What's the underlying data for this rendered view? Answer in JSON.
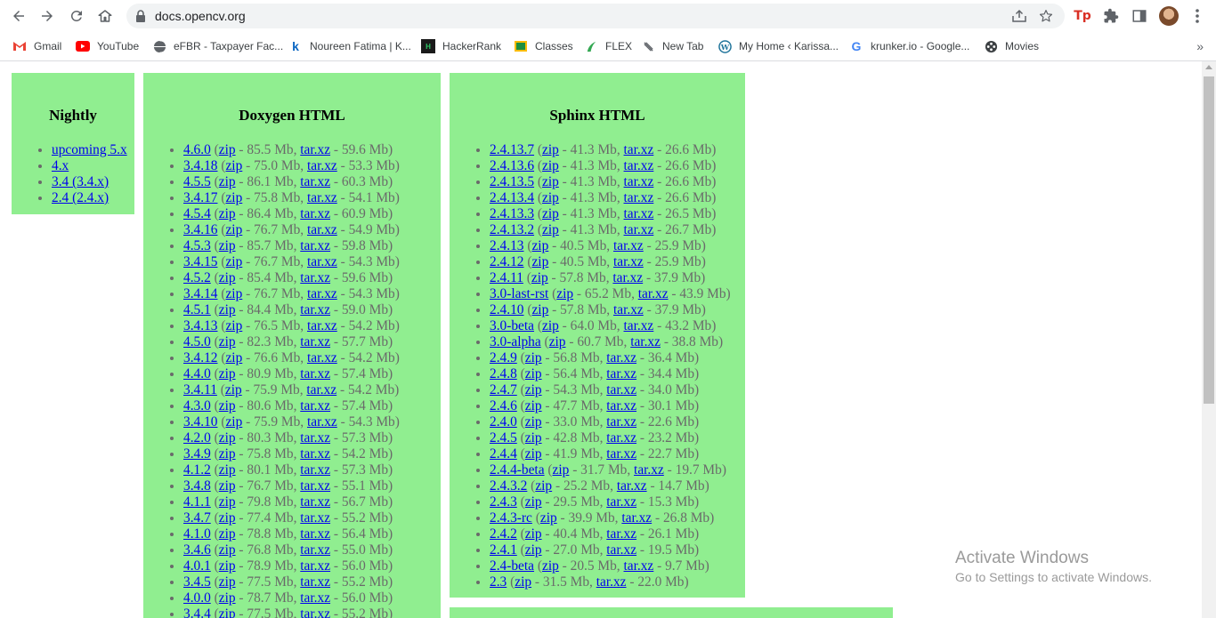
{
  "browser": {
    "url": "docs.opencv.org",
    "bookmarks": [
      {
        "label": "Gmail",
        "icon": "gmail-icon"
      },
      {
        "label": "YouTube",
        "icon": "youtube-icon"
      },
      {
        "label": "eFBR - Taxpayer Fac...",
        "icon": "globe-icon"
      },
      {
        "label": "Noureen Fatima | K...",
        "icon": "k-icon"
      },
      {
        "label": "HackerRank",
        "icon": "hackerrank-icon"
      },
      {
        "label": "Classes",
        "icon": "classes-icon"
      },
      {
        "label": "FLEX",
        "icon": "flex-icon"
      },
      {
        "label": "New Tab",
        "icon": "newtab-icon"
      },
      {
        "label": "My Home ‹ Karissa...",
        "icon": "wordpress-icon"
      },
      {
        "label": "krunker.io - Google...",
        "icon": "google-icon"
      },
      {
        "label": "Movies",
        "icon": "movies-icon"
      }
    ],
    "extension_label": "Tp"
  },
  "nightly": {
    "title": "Nightly",
    "items": [
      {
        "label": "upcoming 5.x"
      },
      {
        "label": "4.x"
      },
      {
        "label": "3.4 (3.4.x)"
      },
      {
        "label": "2.4 (2.4.x)"
      }
    ]
  },
  "doxygen": {
    "title": "Doxygen HTML",
    "zip_label": "zip",
    "tar_label": "tar.xz",
    "items": [
      {
        "version": "4.6.0",
        "zip": "85.5 Mb",
        "tar": "59.6 Mb"
      },
      {
        "version": "3.4.18",
        "zip": "75.0 Mb",
        "tar": "53.3 Mb"
      },
      {
        "version": "4.5.5",
        "zip": "86.1 Mb",
        "tar": "60.3 Mb"
      },
      {
        "version": "3.4.17",
        "zip": "75.8 Mb",
        "tar": "54.1 Mb"
      },
      {
        "version": "4.5.4",
        "zip": "86.4 Mb",
        "tar": "60.9 Mb"
      },
      {
        "version": "3.4.16",
        "zip": "76.7 Mb",
        "tar": "54.9 Mb"
      },
      {
        "version": "4.5.3",
        "zip": "85.7 Mb",
        "tar": "59.8 Mb"
      },
      {
        "version": "3.4.15",
        "zip": "76.7 Mb",
        "tar": "54.3 Mb"
      },
      {
        "version": "4.5.2",
        "zip": "85.4 Mb",
        "tar": "59.6 Mb"
      },
      {
        "version": "3.4.14",
        "zip": "76.7 Mb",
        "tar": "54.3 Mb"
      },
      {
        "version": "4.5.1",
        "zip": "84.4 Mb",
        "tar": "59.0 Mb"
      },
      {
        "version": "3.4.13",
        "zip": "76.5 Mb",
        "tar": "54.2 Mb"
      },
      {
        "version": "4.5.0",
        "zip": "82.3 Mb",
        "tar": "57.7 Mb"
      },
      {
        "version": "3.4.12",
        "zip": "76.6 Mb",
        "tar": "54.2 Mb"
      },
      {
        "version": "4.4.0",
        "zip": "80.9 Mb",
        "tar": "57.4 Mb"
      },
      {
        "version": "3.4.11",
        "zip": "75.9 Mb",
        "tar": "54.2 Mb"
      },
      {
        "version": "4.3.0",
        "zip": "80.6 Mb",
        "tar": "57.4 Mb"
      },
      {
        "version": "3.4.10",
        "zip": "75.9 Mb",
        "tar": "54.3 Mb"
      },
      {
        "version": "4.2.0",
        "zip": "80.3 Mb",
        "tar": "57.3 Mb"
      },
      {
        "version": "3.4.9",
        "zip": "75.8 Mb",
        "tar": "54.2 Mb"
      },
      {
        "version": "4.1.2",
        "zip": "80.1 Mb",
        "tar": "57.3 Mb"
      },
      {
        "version": "3.4.8",
        "zip": "76.7 Mb",
        "tar": "55.1 Mb"
      },
      {
        "version": "4.1.1",
        "zip": "79.8 Mb",
        "tar": "56.7 Mb"
      },
      {
        "version": "3.4.7",
        "zip": "77.4 Mb",
        "tar": "55.2 Mb"
      },
      {
        "version": "4.1.0",
        "zip": "78.8 Mb",
        "tar": "56.4 Mb"
      },
      {
        "version": "3.4.6",
        "zip": "76.8 Mb",
        "tar": "55.0 Mb"
      },
      {
        "version": "4.0.1",
        "zip": "78.9 Mb",
        "tar": "56.0 Mb"
      },
      {
        "version": "3.4.5",
        "zip": "77.5 Mb",
        "tar": "55.2 Mb"
      },
      {
        "version": "4.0.0",
        "zip": "78.7 Mb",
        "tar": "56.0 Mb"
      },
      {
        "version": "3.4.4",
        "zip": "77.5 Mb",
        "tar": "55.2 Mb"
      }
    ]
  },
  "sphinx": {
    "title": "Sphinx HTML",
    "zip_label": "zip",
    "tar_label": "tar.xz",
    "items": [
      {
        "version": "2.4.13.7",
        "zip": "41.3 Mb",
        "tar": "26.6 Mb"
      },
      {
        "version": "2.4.13.6",
        "zip": "41.3 Mb",
        "tar": "26.6 Mb"
      },
      {
        "version": "2.4.13.5",
        "zip": "41.3 Mb",
        "tar": "26.6 Mb"
      },
      {
        "version": "2.4.13.4",
        "zip": "41.3 Mb",
        "tar": "26.6 Mb"
      },
      {
        "version": "2.4.13.3",
        "zip": "41.3 Mb",
        "tar": "26.5 Mb"
      },
      {
        "version": "2.4.13.2",
        "zip": "41.3 Mb",
        "tar": "26.7 Mb"
      },
      {
        "version": "2.4.13",
        "zip": "40.5 Mb",
        "tar": "25.9 Mb"
      },
      {
        "version": "2.4.12",
        "zip": "40.5 Mb",
        "tar": "25.9 Mb"
      },
      {
        "version": "2.4.11",
        "zip": "57.8 Mb",
        "tar": "37.9 Mb"
      },
      {
        "version": "3.0-last-rst",
        "zip": "65.2 Mb",
        "tar": "43.9 Mb"
      },
      {
        "version": "2.4.10",
        "zip": "57.8 Mb",
        "tar": "37.9 Mb"
      },
      {
        "version": "3.0-beta",
        "zip": "64.0 Mb",
        "tar": "43.2 Mb"
      },
      {
        "version": "3.0-alpha",
        "zip": "60.7 Mb",
        "tar": "38.8 Mb"
      },
      {
        "version": "2.4.9",
        "zip": "56.8 Mb",
        "tar": "36.4 Mb"
      },
      {
        "version": "2.4.8",
        "zip": "56.4 Mb",
        "tar": "34.4 Mb"
      },
      {
        "version": "2.4.7",
        "zip": "54.3 Mb",
        "tar": "34.0 Mb"
      },
      {
        "version": "2.4.6",
        "zip": "47.7 Mb",
        "tar": "30.1 Mb"
      },
      {
        "version": "2.4.0",
        "zip": "33.0 Mb",
        "tar": "22.6 Mb"
      },
      {
        "version": "2.4.5",
        "zip": "42.8 Mb",
        "tar": "23.2 Mb"
      },
      {
        "version": "2.4.4",
        "zip": "41.9 Mb",
        "tar": "22.7 Mb"
      },
      {
        "version": "2.4.4-beta",
        "zip": "31.7 Mb",
        "tar": "19.7 Mb"
      },
      {
        "version": "2.4.3.2",
        "zip": "25.2 Mb",
        "tar": "14.7 Mb"
      },
      {
        "version": "2.4.3",
        "zip": "29.5 Mb",
        "tar": "15.3 Mb"
      },
      {
        "version": "2.4.3-rc",
        "zip": "39.9 Mb",
        "tar": "26.8 Mb"
      },
      {
        "version": "2.4.2",
        "zip": "40.4 Mb",
        "tar": "26.1 Mb"
      },
      {
        "version": "2.4.1",
        "zip": "27.0 Mb",
        "tar": "19.5 Mb"
      },
      {
        "version": "2.4-beta",
        "zip": "20.5 Mb",
        "tar": "9.7 Mb"
      },
      {
        "version": "2.3",
        "zip": "31.5 Mb",
        "tar": "22.0 Mb"
      }
    ]
  },
  "watermark": {
    "line1": "Activate Windows",
    "line2": "Go to Settings to activate Windows."
  },
  "colors": {
    "panel_bg": "#90ee90",
    "link": "#0000ee",
    "size_text": "#6a6a6a"
  }
}
